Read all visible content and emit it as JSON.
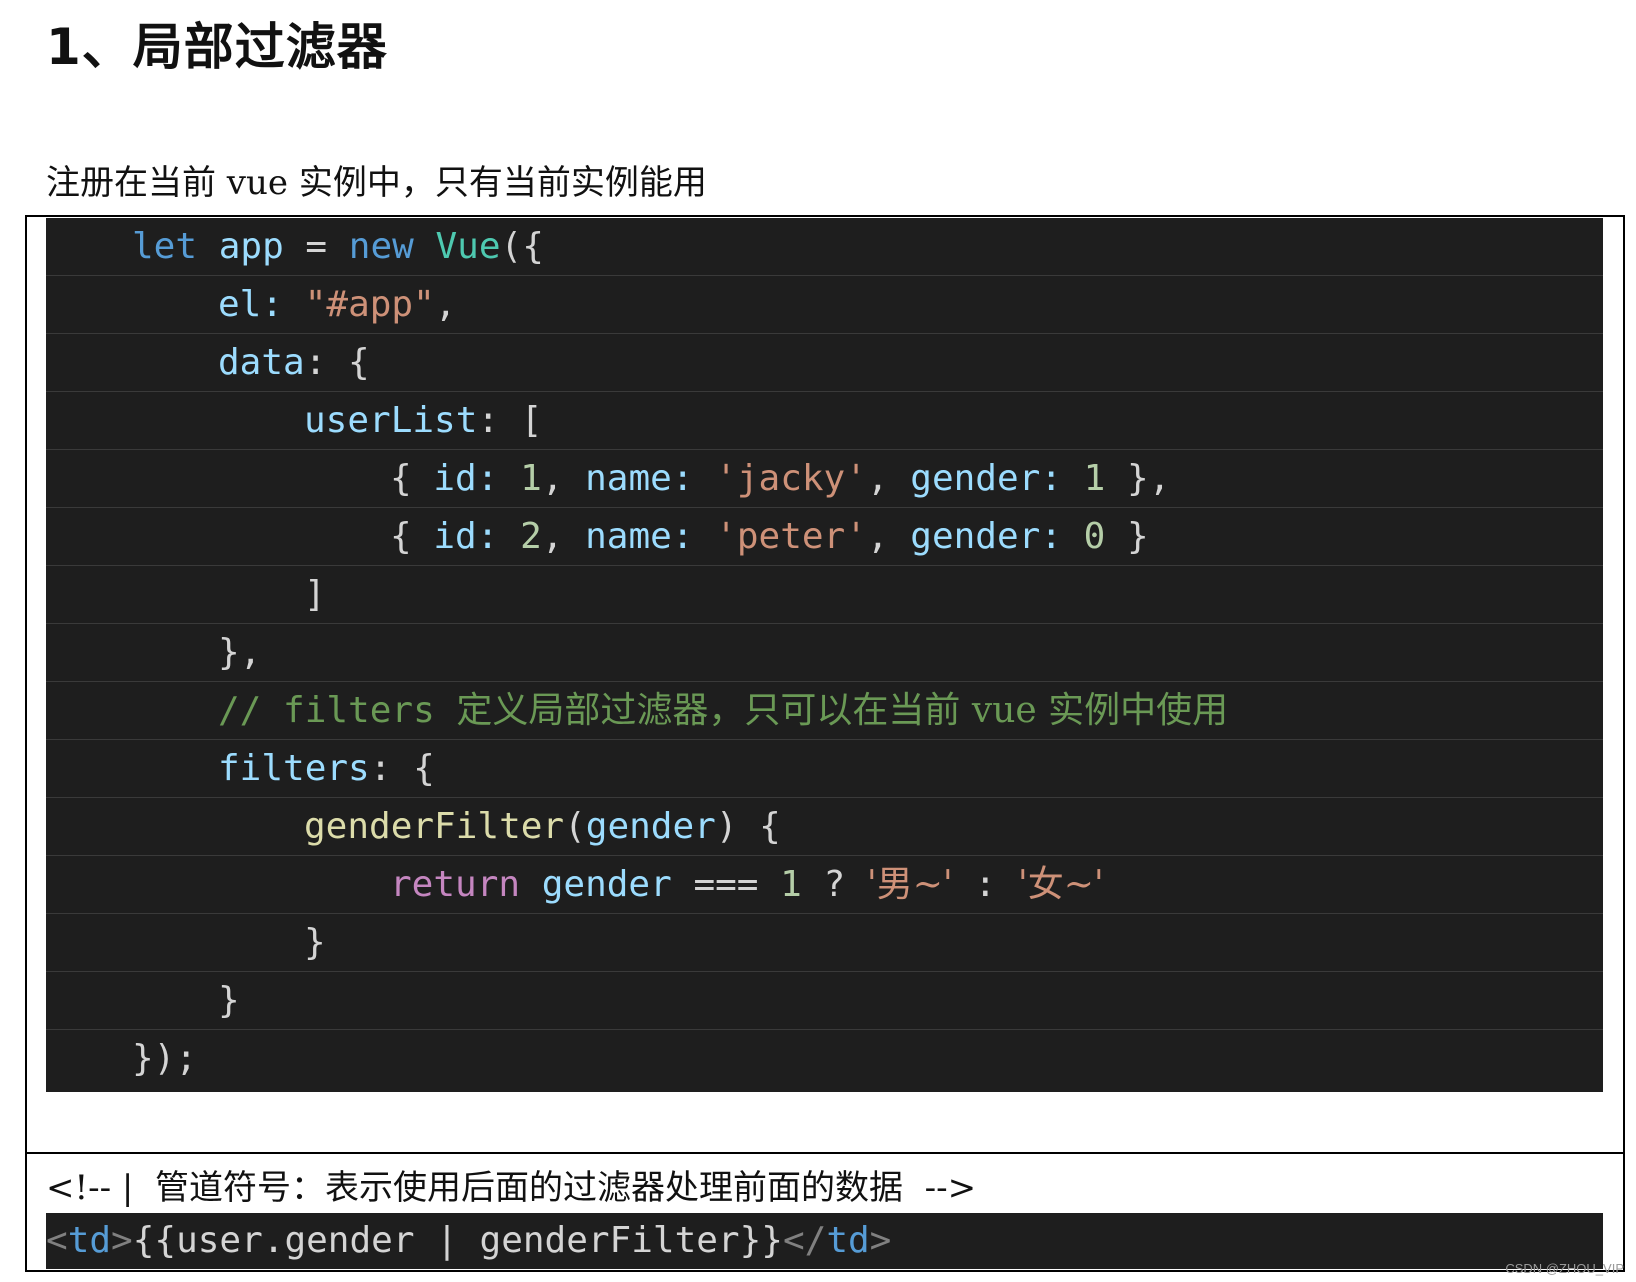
{
  "heading": "1、局部过滤器",
  "intro": "注册在当前 vue 实例中，只有当前实例能用",
  "code": {
    "l1": {
      "kw": "let",
      "var": "app",
      "eq": " = ",
      "kw2": "new",
      "cls": "Vue",
      "tail": "({"
    },
    "l2": {
      "key": "el",
      "colon": ": ",
      "str": "\"#app\"",
      "tail": ","
    },
    "l3": {
      "key": "data",
      "tail": ": {"
    },
    "l4": {
      "key": "userList",
      "tail": ": ["
    },
    "l5": {
      "open": "{ ",
      "k1": "id",
      "c1": ": ",
      "v1": "1",
      "s1": ", ",
      "k2": "name",
      "c2": ": ",
      "v2": "'jacky'",
      "s2": ", ",
      "k3": "gender",
      "c3": ": ",
      "v3": "1",
      "close": " },"
    },
    "l6": {
      "open": "{ ",
      "k1": "id",
      "c1": ": ",
      "v1": "2",
      "s1": ", ",
      "k2": "name",
      "c2": ": ",
      "v2": "'peter'",
      "s2": ", ",
      "k3": "gender",
      "c3": ": ",
      "v3": "0",
      "close": " }"
    },
    "l7": "]",
    "l8": "},",
    "l9": {
      "prefix": "// filters ",
      "text": "定义局部过滤器，只可以在当前 vue 实例中使用"
    },
    "l10": {
      "key": "filters",
      "tail": ": {"
    },
    "l11": {
      "fn": "genderFilter",
      "open": "(",
      "param": "gender",
      "close": ") {"
    },
    "l12": {
      "ret": "return",
      "sp": " ",
      "var": "gender",
      "op": " === ",
      "num": "1",
      "q": " ? ",
      "s1": "'男~'",
      "colon": " : ",
      "s2": "'女~'"
    },
    "l13": "}",
    "l14": "}",
    "l15": "});"
  },
  "pipe_note": "<!-- |  管道符号：表示使用后面的过滤器处理前面的数据  -->",
  "template": {
    "lt1": "<",
    "tag1": "td",
    "gt1": ">",
    "expr": "{{user.gender | genderFilter}}",
    "lt2": "</",
    "tag2": "td",
    "gt2": ">"
  },
  "watermark": "CSDN @ZHOU_VIP",
  "colors": {
    "code_bg": "#1e1e1e",
    "keyword": "#569cd6",
    "property": "#9cdcfe",
    "class": "#4ec9b0",
    "string": "#ce9178",
    "number": "#b5cea8",
    "function": "#dcdcaa",
    "control": "#c586c0",
    "comment": "#6a9955"
  }
}
